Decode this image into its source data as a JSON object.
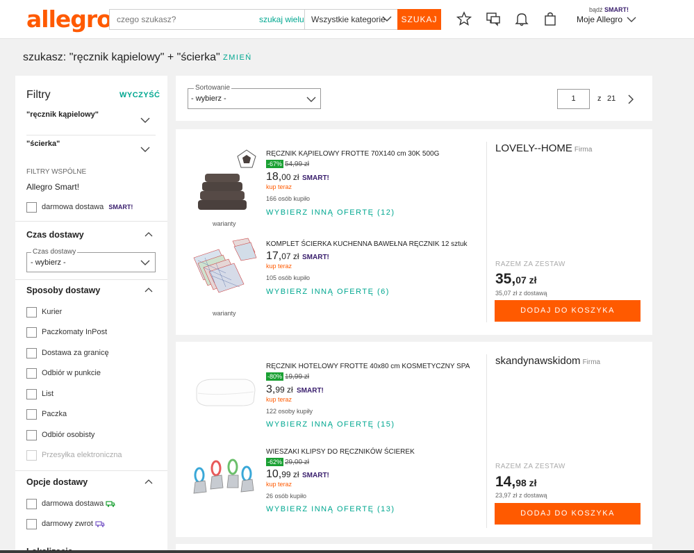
{
  "header": {
    "logo": "allegro",
    "search_placeholder": "czego szukasz?",
    "search_many": "szukaj wielu",
    "category": "Wszystkie kategorie",
    "search_button": "SZUKAJ",
    "smart_prefix": "bądź",
    "smart_label": "SMART!",
    "my_allegro": "Moje Allegro",
    "icons": [
      "star-icon",
      "chat-icon",
      "bell-icon",
      "bag-icon"
    ]
  },
  "query": {
    "text": "szukasz: \"ręcznik kąpielowy\" + \"ścierka\"",
    "change": "ZMIEŃ"
  },
  "sidebar": {
    "title": "Filtry",
    "clear": "WYCZYŚĆ",
    "terms": [
      "\"ręcznik kąpielowy\"",
      "\"ścierka\""
    ],
    "common_filters": "FILTRY WSPÓLNE",
    "allegro_smart": "Allegro Smart!",
    "free_delivery": "darmowa dostawa",
    "smart_badge": "SMART!",
    "delivery_time": {
      "title": "Czas dostawy",
      "select_label": "Czas dostawy",
      "select_value": "- wybierz -"
    },
    "delivery_methods": {
      "title": "Sposoby dostawy",
      "items": [
        "Kurier",
        "Paczkomaty InPost",
        "Dostawa za granicę",
        "Odbiór w punkcie",
        "List",
        "Paczka",
        "Odbiór osobisty",
        "Przesyłka elektroniczna"
      ]
    },
    "delivery_options": {
      "title": "Opcje dostawy",
      "items": [
        "darmowa dostawa",
        "darmowy zwrot"
      ]
    },
    "location": "Lokalizacja"
  },
  "sortbar": {
    "label": "Sortowanie",
    "value": "- wybierz -",
    "page": "1",
    "of": "z",
    "total_pages": "21"
  },
  "sets": [
    {
      "seller": "LOVELY--HOME",
      "firma": "Firma",
      "total_label": "RAZEM ZA ZESTAW",
      "total_int": "35,",
      "total_dec": "07 zł",
      "with_delivery": "35,07 zł z dostawą",
      "add_button": "DODAJ DO KOSZYKA",
      "items": [
        {
          "title": "RĘCZNIK KĄPIELOWY FROTTE 70X140 cm 30K 500G",
          "discount": "-67%",
          "old_price": "54,99 zł",
          "price_int": "18,",
          "price_dec": "00 zł",
          "smart": "SMART!",
          "buy_now": "kup teraz",
          "bought": "166 osób kupiło",
          "other": "WYBIERZ INNĄ OFERTĘ (12)",
          "variants": "warianty"
        },
        {
          "title": "KOMPLET ŚCIERKA KUCHENNA BAWEŁNA RĘCZNIK 12 sztuk",
          "discount": "",
          "old_price": "",
          "price_int": "17,",
          "price_dec": "07 zł",
          "smart": "SMART!",
          "buy_now": "kup teraz",
          "bought": "105 osób kupiło",
          "other": "WYBIERZ INNĄ OFERTĘ (6)",
          "variants": "warianty"
        }
      ]
    },
    {
      "seller": "skandynawskidom",
      "firma": "Firma",
      "total_label": "RAZEM ZA ZESTAW",
      "total_int": "14,",
      "total_dec": "98 zł",
      "with_delivery": "23,97 zł z dostawą",
      "add_button": "DODAJ DO KOSZYKA",
      "items": [
        {
          "title": "RĘCZNIK HOTELOWY FROTTE 40x80 cm KOSMETYCZNY SPA",
          "discount": "-80%",
          "old_price": "19,99 zł",
          "price_int": "3,",
          "price_dec": "99 zł",
          "smart": "SMART!",
          "buy_now": "kup teraz",
          "bought": "122 osoby kupiły",
          "other": "WYBIERZ INNĄ OFERTĘ (15)"
        },
        {
          "title": "WIESZAKI KLIPSY DO RĘCZNIKÓW ŚCIEREK",
          "discount": "-62%",
          "old_price": "29,00 zł",
          "price_int": "10,",
          "price_dec": "99 zł",
          "smart": "SMART!",
          "buy_now": "kup teraz",
          "bought": "26 osób kupiło",
          "other": "WYBIERZ INNĄ OFERTĘ (13)"
        }
      ]
    }
  ]
}
